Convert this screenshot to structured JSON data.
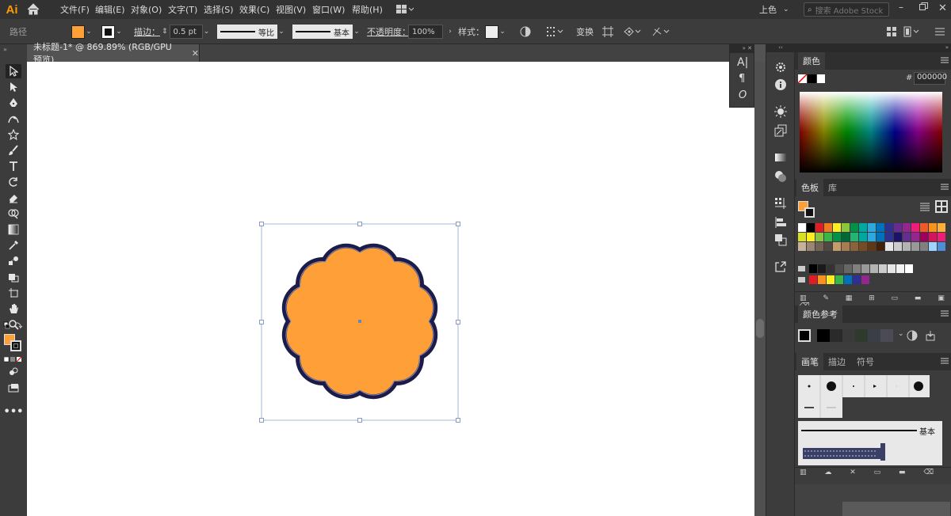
{
  "app": {
    "logo": "Ai"
  },
  "menu": {
    "items": [
      "文件(F)",
      "编辑(E)",
      "对象(O)",
      "文字(T)",
      "选择(S)",
      "效果(C)",
      "视图(V)",
      "窗口(W)",
      "帮助(H)"
    ],
    "workspace": "上色",
    "search_placeholder": "搜索 Adobe Stock"
  },
  "control": {
    "object_type": "路径",
    "stroke_label": "描边：",
    "stroke_weight": "0.5 pt",
    "profile_label": "等比",
    "brush_label": "基本",
    "opacity_label": "不透明度：",
    "opacity_value": "100%",
    "style_label": "样式：",
    "transform_label": "变换",
    "fill_color": "#ff9f38",
    "stroke_color": "#111111"
  },
  "document": {
    "tab_title": "未标题-1* @ 869.89% (RGB/GPU 预览)"
  },
  "artwork": {
    "fill": "#ff9f38",
    "stroke": "#1c1c48",
    "inner_stroke": "#8a8ab0",
    "lobes": 12
  },
  "panels": {
    "color": {
      "title": "颜色",
      "hex_label": "#",
      "hex_value": "000000"
    },
    "swatches": {
      "tabs": [
        "色板",
        "库"
      ]
    },
    "color_guide": {
      "title": "颜色参考"
    },
    "brushes": {
      "tabs": [
        "画笔",
        "描边",
        "符号"
      ],
      "basic_label": "基本"
    }
  },
  "swatches": {
    "row1": [
      "#ffffff",
      "#000000",
      "#e31c23",
      "#ee7b22",
      "#fcee21",
      "#8cc63f",
      "#009245",
      "#00a99d",
      "#29abe2",
      "#0071bc",
      "#2e3192",
      "#662d91",
      "#93278f",
      "#ed1e79",
      "#f15a24",
      "#f7931e",
      "#fbb03b"
    ],
    "row2": [
      "#d9e021",
      "#fcee21",
      "#8cc63f",
      "#39b54a",
      "#009245",
      "#006837",
      "#22b573",
      "#00a99d",
      "#29abe2",
      "#0071bc",
      "#2e3192",
      "#1b1464",
      "#662d91",
      "#93278f",
      "#9e005d",
      "#d4145a",
      "#ed1e79"
    ],
    "row3": [
      "#c7b299",
      "#998675",
      "#736357",
      "#534741",
      "#c69c6d",
      "#a67c52",
      "#8c6239",
      "#754c24",
      "#603813",
      "#42210b",
      "#e6e6e6",
      "#cccccc",
      "#b3b3b3",
      "#999999",
      "#808080",
      "#9fd4ff",
      "#4d8fd6"
    ],
    "grays": [
      "#000000",
      "#1a1a1a",
      "#333333",
      "#4d4d4d",
      "#666666",
      "#808080",
      "#999999",
      "#b3b3b3",
      "#cccccc",
      "#e6e6e6",
      "#f2f2f2",
      "#ffffff"
    ],
    "brights": [
      "#e31c23",
      "#f7931e",
      "#fcee21",
      "#39b54a",
      "#0071bc",
      "#2e3192",
      "#93278f"
    ],
    "guide": [
      "#000000",
      "#2a2a2a",
      "#3a3a3a",
      "#2f3a2f",
      "#3a3f47",
      "#4b4b55"
    ]
  }
}
